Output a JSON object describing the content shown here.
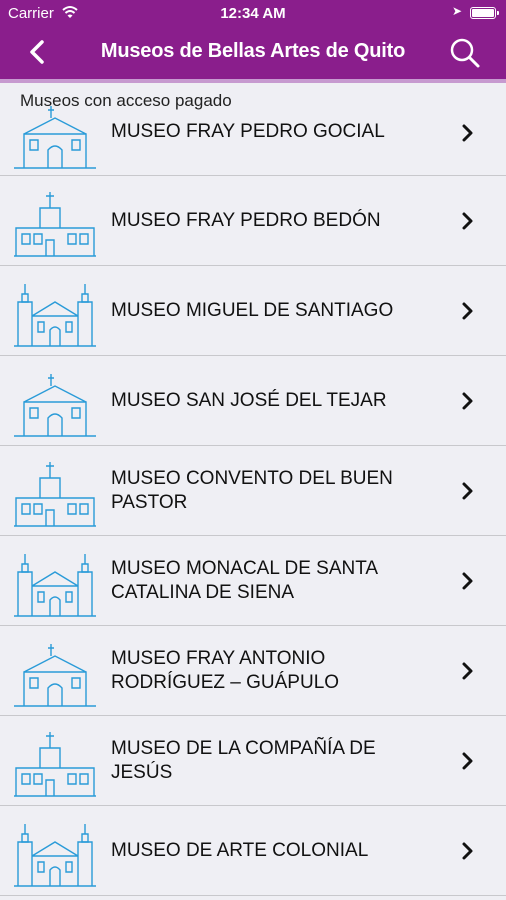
{
  "status_bar": {
    "carrier": "Carrier",
    "time": "12:34 AM"
  },
  "nav": {
    "title": "Museos de Bellas Artes de Quito",
    "back_icon": "chevron-left-icon",
    "search_icon": "search-icon"
  },
  "section_header": "Museos con acceso pagado",
  "colors": {
    "nav_bg": "#8a1e8c",
    "icon_blue": "#2a9bd8"
  },
  "museums": [
    {
      "name": "MUSEO FRAY PEDRO GOCIAL"
    },
    {
      "name": "MUSEO FRAY PEDRO BEDÓN"
    },
    {
      "name": "MUSEO MIGUEL DE SANTIAGO"
    },
    {
      "name": "MUSEO SAN JOSÉ DEL TEJAR"
    },
    {
      "name": "MUSEO CONVENTO DEL BUEN PASTOR"
    },
    {
      "name": "MUSEO MONACAL DE SANTA CATALINA DE SIENA"
    },
    {
      "name": "MUSEO FRAY ANTONIO RODRÍGUEZ – GUÁPULO"
    },
    {
      "name": "MUSEO DE LA COMPAÑÍA DE JESÚS"
    },
    {
      "name": "MUSEO DE ARTE COLONIAL"
    }
  ]
}
